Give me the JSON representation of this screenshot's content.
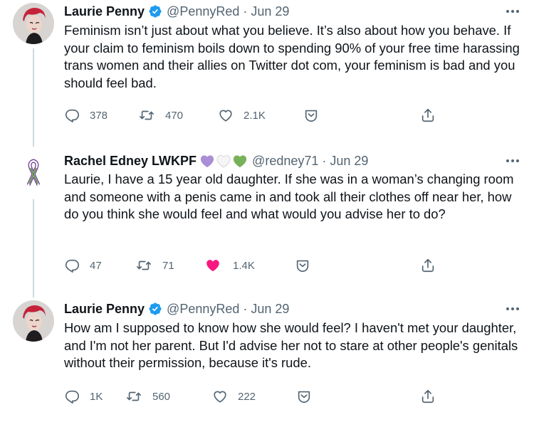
{
  "tweets": [
    {
      "name": "Laurie Penny",
      "handle": "@PennyRed",
      "date": "Jun 29",
      "text": "Feminism isn’t just about what you believe. It’s also about how you behave. If your claim to feminism boils down to spending 90% of your free time harassing trans women and their allies on Twitter dot com, your feminism is bad and you should feel bad.",
      "replies": "378",
      "retweets": "470",
      "likes": "2.1K"
    },
    {
      "name": "Rachel Edney LWKPF",
      "name_emoji": [
        "purple-heart",
        "white-heart",
        "green-heart"
      ],
      "handle": "@redney71",
      "date": "Jun 29",
      "text": "Laurie, I have a 15 year old daughter. If she was in a woman’s changing room and someone with a penis came in  and took all their clothes off near her, how do you think she would feel and what would you advise her to do?",
      "replies": "47",
      "retweets": "71",
      "likes": "1.4K",
      "liked": true
    },
    {
      "name": "Laurie Penny",
      "handle": "@PennyRed",
      "date": "Jun 29",
      "text": "How am I supposed to know how she would feel? I haven't met your daughter, and I'm not her parent. But I'd advise her not to stare at other people's genitals without their permission, because it's rude.",
      "replies": "1K",
      "retweets": "560",
      "likes": "222"
    }
  ],
  "colors": {
    "verified": "#1d9bf0",
    "like_active": "#f91880",
    "muted": "#536471",
    "text": "#0f1419",
    "purple_heart": "#aa8ed6",
    "green_heart": "#78b159"
  }
}
